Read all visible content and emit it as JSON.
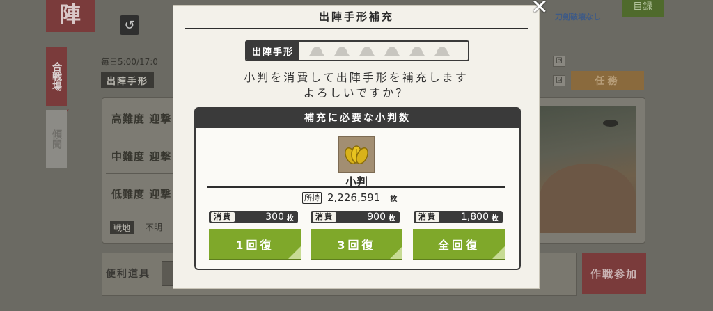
{
  "background": {
    "title_char": "陣",
    "reset_text": "毎日5:00/17:0",
    "sortie_label": "出陣手形",
    "side_tabs": [
      "合戦場",
      "傾聞"
    ],
    "difficulty_rows": [
      "高難度 迎撃",
      "中難度 迎撃",
      "低難度 迎撃"
    ],
    "enemy_label": "戦地",
    "enemy_value": "不明",
    "quest_label": "任務",
    "menu_label": "目録",
    "sword_badge": "刀剣破壊なし",
    "items_label": "便利道具",
    "join_label": "作戦参加",
    "back_icon": "↺",
    "check_icon": "✓",
    "box_char": "回"
  },
  "modal": {
    "title": "出陣手形補充",
    "close_icon": "✕",
    "slot_label": "出陣手形",
    "slot_count": 6,
    "message_line1": "小判を消費して出陣手形を補充します",
    "message_line2": "よろしいですか？",
    "cost_header": "補充に必要な小判数",
    "currency_name": "小判",
    "owned_tag": "所持",
    "owned_amount": "2,226,591",
    "unit": "枚",
    "options": [
      {
        "consume_tag": "消費",
        "cost": "300",
        "button": "1回復"
      },
      {
        "consume_tag": "消費",
        "cost": "900",
        "button": "3回復"
      },
      {
        "consume_tag": "消費",
        "cost": "1,800",
        "button": "全回復"
      }
    ]
  },
  "colors": {
    "accent_green": "#7fa82a",
    "dark": "#3a3a3a",
    "panel": "#f3f1ea"
  }
}
